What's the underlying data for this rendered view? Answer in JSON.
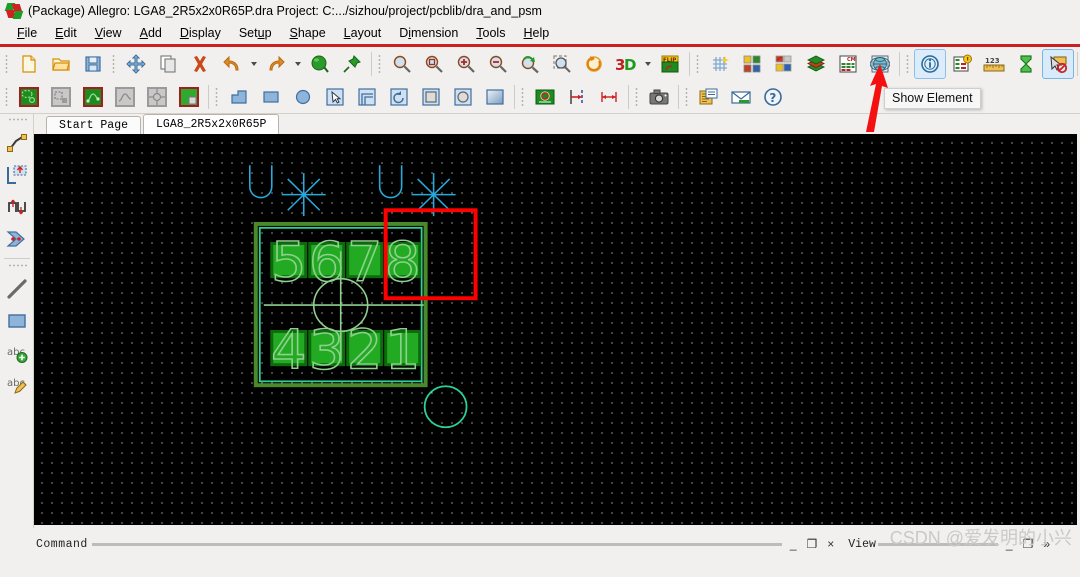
{
  "window": {
    "app_icon": "allegro-logo-icon",
    "title": "(Package) Allegro: LGA8_2R5x2x0R65P.dra   Project: C:.../sizhou/project/pcblib/dra_and_psm"
  },
  "menu": {
    "items": [
      {
        "label": "File",
        "mnemonic": "F"
      },
      {
        "label": "Edit",
        "mnemonic": "E"
      },
      {
        "label": "View",
        "mnemonic": "V"
      },
      {
        "label": "Add",
        "mnemonic": "A"
      },
      {
        "label": "Display",
        "mnemonic": "D"
      },
      {
        "label": "Setup",
        "mnemonic": "u"
      },
      {
        "label": "Shape",
        "mnemonic": "S"
      },
      {
        "label": "Layout",
        "mnemonic": "L"
      },
      {
        "label": "Dimension",
        "mnemonic": "i"
      },
      {
        "label": "Tools",
        "mnemonic": "T"
      },
      {
        "label": "Help",
        "mnemonic": "H"
      }
    ]
  },
  "toolbar_row1": [
    {
      "name": "new-file-button",
      "icon": "new-document-icon"
    },
    {
      "name": "open-file-button",
      "icon": "open-folder-icon"
    },
    {
      "name": "save-button",
      "icon": "floppy-save-icon"
    },
    {
      "name": "move-button",
      "icon": "move-arrows-icon"
    },
    {
      "name": "copy-button",
      "icon": "copy-pages-icon"
    },
    {
      "name": "delete-button",
      "icon": "red-x-delete-icon"
    },
    {
      "name": "undo-button",
      "icon": "undo-arrow-icon"
    },
    {
      "name": "undo-dropdown",
      "icon": "chevron-down-icon"
    },
    {
      "name": "redo-button",
      "icon": "redo-arrow-icon"
    },
    {
      "name": "redo-dropdown",
      "icon": "chevron-down-icon"
    },
    {
      "name": "color-button",
      "icon": "green-sphere-icon"
    },
    {
      "name": "pin-button",
      "icon": "green-pushpin-icon"
    },
    {
      "name": "zoom-fit-button",
      "icon": "zoom-fit-icon"
    },
    {
      "name": "zoom-in-window-button",
      "icon": "zoom-window-icon"
    },
    {
      "name": "zoom-in-button",
      "icon": "zoom-in-icon"
    },
    {
      "name": "zoom-out-button",
      "icon": "zoom-out-icon"
    },
    {
      "name": "zoom-previous-button",
      "icon": "zoom-previous-icon"
    },
    {
      "name": "zoom-points-button",
      "icon": "zoom-points-icon"
    },
    {
      "name": "refresh-button",
      "icon": "orange-refresh-icon"
    },
    {
      "name": "view-3d-button",
      "icon": "3d-icon"
    },
    {
      "name": "view-3d-dropdown",
      "icon": "chevron-down-icon"
    },
    {
      "name": "flip-design-button",
      "icon": "flip-icon"
    },
    {
      "name": "grid-toggle-button",
      "icon": "grid-sparkle-icon"
    },
    {
      "name": "color-visibility-button",
      "icon": "color-squares-icon"
    },
    {
      "name": "subclass-button",
      "icon": "subclass-squares-icon"
    },
    {
      "name": "layers-button",
      "icon": "layer-stack-icon"
    },
    {
      "name": "constraint-manager-button",
      "icon": "constraint-manager-icon"
    },
    {
      "name": "globe-button",
      "icon": "globe-grid-icon"
    },
    {
      "name": "show-element-button",
      "icon": "info-circle-icon"
    },
    {
      "name": "show-measure-button",
      "icon": "report-info-icon"
    },
    {
      "name": "measure-button",
      "icon": "ruler-123-icon"
    },
    {
      "name": "timing-button",
      "icon": "hourglass-icon"
    },
    {
      "name": "show-no-select-button",
      "icon": "cursor-no-select-icon"
    },
    {
      "name": "add-via-button",
      "icon": "add-circle-icon"
    },
    {
      "name": "extra-button",
      "icon": "green-chip-icon"
    }
  ],
  "toolbar_row2": [
    {
      "name": "shape-add-button",
      "icon": "shape-green-icon"
    },
    {
      "name": "shape-edit-button",
      "icon": "shape-gray-icon"
    },
    {
      "name": "net-shape-button",
      "icon": "net-shape-icon"
    },
    {
      "name": "plane-button",
      "icon": "plane-gray-icon"
    },
    {
      "name": "thermal-button",
      "icon": "thermal-gray-icon"
    },
    {
      "name": "shape-fill-button",
      "icon": "shape-fill-icon"
    },
    {
      "name": "line-polygon-button",
      "icon": "polyline-shape-icon"
    },
    {
      "name": "rectangle-button",
      "icon": "rectangle-shape-icon"
    },
    {
      "name": "circle-button",
      "icon": "circle-shape-icon"
    },
    {
      "name": "select-shape-button",
      "icon": "cursor-select-icon"
    },
    {
      "name": "nested-shape-button",
      "icon": "nested-shape-icon"
    },
    {
      "name": "rotate-button",
      "icon": "rotate-arc-icon"
    },
    {
      "name": "filled-rect-button",
      "icon": "filled-rect-icon"
    },
    {
      "name": "filled-circle-button",
      "icon": "filled-circle-icon"
    },
    {
      "name": "gradient-button",
      "icon": "gradient-shape-icon"
    },
    {
      "name": "padstack-button",
      "icon": "padstack-icon"
    },
    {
      "name": "dimension-h-button",
      "icon": "dimension-left-icon"
    },
    {
      "name": "dimension-w-button",
      "icon": "dimension-width-icon"
    },
    {
      "name": "snapshot-button",
      "icon": "camera-icon"
    },
    {
      "name": "reports-button",
      "icon": "reports-icon"
    },
    {
      "name": "mail-button",
      "icon": "envelope-icon"
    },
    {
      "name": "help-button",
      "icon": "help-question-icon"
    }
  ],
  "tooltip": {
    "text": "Show Element",
    "pointer": "red-arrow-annotation"
  },
  "left_dock": [
    {
      "name": "add-connect-button",
      "icon": "add-connect-icon"
    },
    {
      "name": "place-manual-button",
      "icon": "place-manual-icon"
    },
    {
      "name": "swap-pins-button",
      "icon": "swap-pins-icon"
    },
    {
      "name": "route-button",
      "icon": "route-flow-icon"
    },
    {
      "name": "add-line-button",
      "icon": "line-icon"
    },
    {
      "name": "add-rect-button",
      "icon": "rect-icon"
    },
    {
      "name": "add-text-button",
      "icon": "abc-add-icon"
    },
    {
      "name": "edit-text-button",
      "icon": "abc-edit-icon"
    }
  ],
  "tabs": [
    {
      "label": "Start Page",
      "active": false
    },
    {
      "label": "LGA8_2R5x2x0R65P",
      "active": true
    }
  ],
  "canvas": {
    "background": "#000000",
    "grid_color": "#ffffff",
    "grid_spacing_px": 10,
    "pads": {
      "fill": "#22aa22",
      "outline": "#0d7a0d",
      "label_color": "#8fd08f",
      "top_row_labels": [
        "5",
        "6",
        "7",
        "8"
      ],
      "bottom_row_labels": [
        "4",
        "3",
        "2",
        "1"
      ]
    },
    "place_bound_color": "#2ecf9a",
    "assembly_outline_color": "#4a8a2a",
    "ref_des_symbols": [
      {
        "name": "u-symbol-left",
        "text": "U",
        "color": "#2aa8d8"
      },
      {
        "name": "asterisk-symbol-left",
        "text": "*",
        "color": "#2aa8d8"
      },
      {
        "name": "u-symbol-right",
        "text": "U",
        "color": "#2aa8d8"
      },
      {
        "name": "asterisk-symbol-right",
        "text": "*",
        "color": "#2aa8d8"
      }
    ],
    "selection_rect": {
      "name": "selection-highlight",
      "color": "#ff0000"
    },
    "pin1_circle_color": "#2ecf9a",
    "origin_crosshair_color": "#8fd08f"
  },
  "statusbar": {
    "command_label": "Command",
    "view_label": "View",
    "minimize_glyph": "_",
    "restore_glyph": "❐",
    "close_glyph": "×",
    "chevron_glyph": "»",
    "watermark": "CSDN @爱发明的小兴"
  }
}
